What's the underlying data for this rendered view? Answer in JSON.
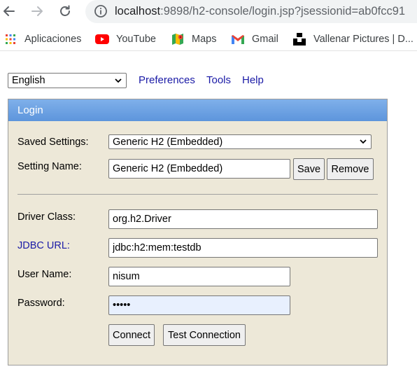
{
  "browser": {
    "url_host": "localhost",
    "url_rest": ":9898/h2-console/login.jsp?jsessionid=ab0fcc91",
    "bookmarks": [
      {
        "label": "Aplicaciones",
        "icon": "apps-grid-icon"
      },
      {
        "label": "YouTube",
        "icon": "youtube-icon"
      },
      {
        "label": "Maps",
        "icon": "maps-icon"
      },
      {
        "label": "Gmail",
        "icon": "gmail-icon"
      },
      {
        "label": "Vallenar Pictures | D...",
        "icon": "unsplash-icon"
      }
    ]
  },
  "toolbar": {
    "language": "English",
    "preferences": "Preferences",
    "tools": "Tools",
    "help": "Help"
  },
  "login": {
    "header": "Login",
    "saved_settings_label": "Saved Settings:",
    "saved_settings_value": "Generic H2 (Embedded)",
    "setting_name_label": "Setting Name:",
    "setting_name_value": "Generic H2 (Embedded)",
    "save_label": "Save",
    "remove_label": "Remove",
    "driver_class_label": "Driver Class:",
    "driver_class_value": "org.h2.Driver",
    "jdbc_url_label": "JDBC URL:",
    "jdbc_url_value": "jdbc:h2:mem:testdb",
    "user_name_label": "User Name:",
    "user_name_value": "nisum",
    "password_label": "Password:",
    "password_value": "•••••",
    "connect_label": "Connect",
    "test_connection_label": "Test Connection"
  },
  "colors": {
    "panel_bg": "#ede8d8",
    "header_bg": "#6aa0e2",
    "link": "#1a1aa6"
  }
}
